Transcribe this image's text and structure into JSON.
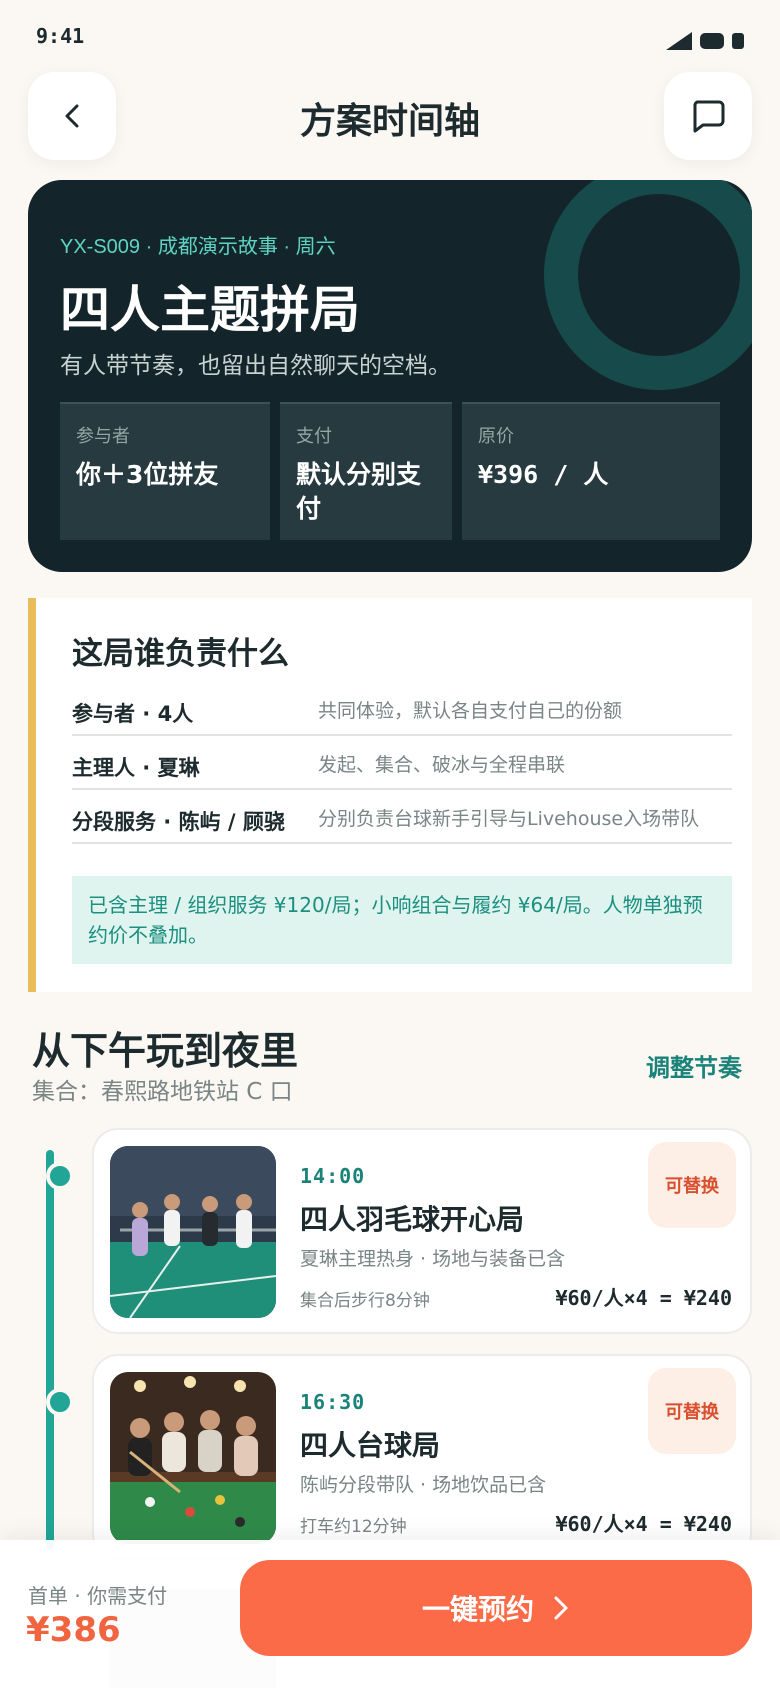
{
  "status": {
    "time": "9:41"
  },
  "header": {
    "title": "方案时间轴"
  },
  "hero": {
    "meta": "YX-S009 · 成都演示故事 · 周六",
    "title": "四人主题拼局",
    "subtitle": "有人带节奏，也留出自然聊天的空档。",
    "stats": [
      {
        "label": "参与者",
        "value": "你＋3位拼友"
      },
      {
        "label": "支付",
        "value": "默认分别支付"
      },
      {
        "label": "原价",
        "value": "¥396 / 人"
      }
    ]
  },
  "roles": {
    "title": "这局谁负责什么",
    "rows": [
      {
        "name": "参与者 · 4人",
        "desc": "共同体验，默认各自支付自己的份额"
      },
      {
        "name": "主理人 · 夏琳",
        "desc": "发起、集合、破冰与全程串联"
      },
      {
        "name": "分段服务 · 陈屿 / 顾骁",
        "desc": "分别负责台球新手引导与Livehouse入场带队"
      }
    ],
    "note": "已含主理 / 组织服务 ¥120/局；小响组合与履约 ¥64/局。人物单独预约价不叠加。"
  },
  "timeline": {
    "title": "从下午玩到夜里",
    "meeting": "集合：春熙路地铁站 C 口",
    "adjust_label": "调整节奏",
    "items": [
      {
        "time": "14:00",
        "name": "四人羽毛球开心局",
        "desc": "夏琳主理热身 · 场地与装备已含",
        "travel": "集合后步行8分钟",
        "price": "¥60/人×4 = ¥240",
        "badge": "可替换",
        "image": "badminton-photo"
      },
      {
        "time": "16:30",
        "name": "四人台球局",
        "desc": "陈屿分段带队 · 场地饮品已含",
        "travel": "打车约12分钟",
        "price": "¥60/人×4 = ¥240",
        "badge": "可替换",
        "image": "billiards-photo"
      }
    ]
  },
  "footer": {
    "pay_label": "首单 · 你需支付",
    "pay_amount": "¥386",
    "book_label": "一键预约"
  },
  "colors": {
    "accent": "#21a596",
    "brand_orange": "#fb6b48",
    "hero_bg": "#13252a",
    "highlight_bar": "#e9bd5a"
  }
}
